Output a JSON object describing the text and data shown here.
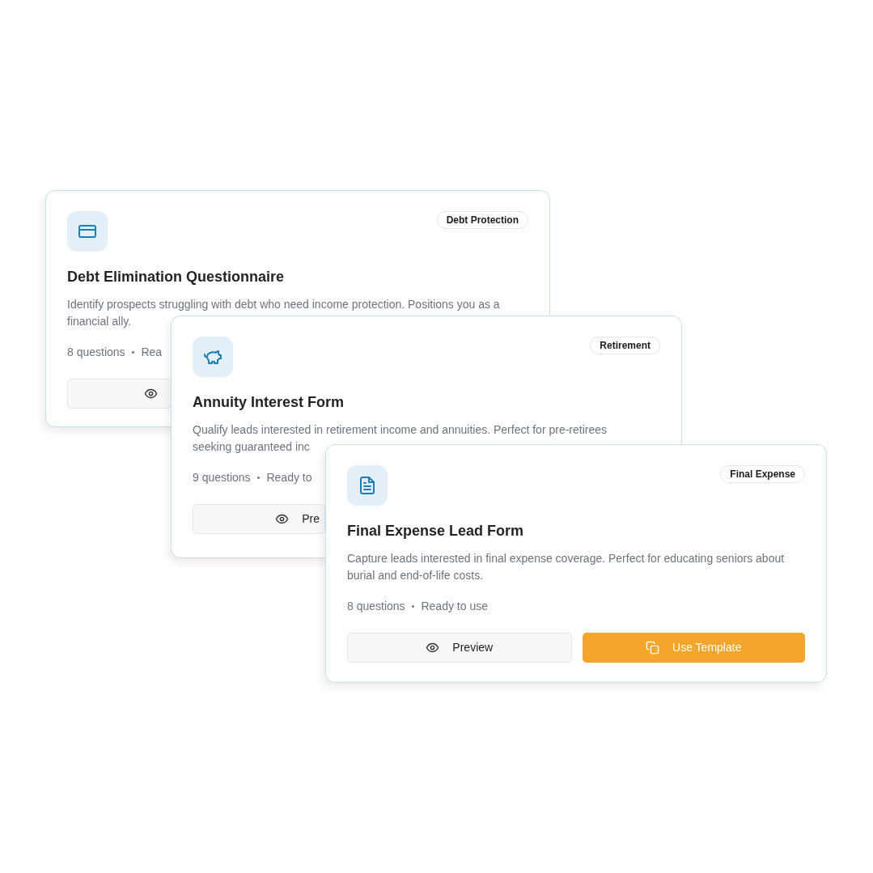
{
  "cards": [
    {
      "tag": "Debt Protection",
      "title": "Debt Elimination Questionnaire",
      "description": "Identify prospects struggling with debt who need income protection. Positions you as a financial ally.",
      "questions": "8 questions",
      "separator": "•",
      "status": "Rea",
      "buttons": [
        {
          "kind": "preview"
        }
      ]
    },
    {
      "tag": "Retirement",
      "title": "Annuity Interest Form",
      "description": "Qualify leads interested in retirement income and annuities. Perfect for pre-retirees seeking guaranteed inc",
      "questions": "9 questions",
      "separator": "•",
      "status": "Ready to",
      "buttons": [
        {
          "kind": "preview",
          "label": "Pre"
        }
      ]
    },
    {
      "tag": "Final Expense",
      "title": "Final Expense Lead Form",
      "description": "Capture leads interested in final expense coverage. Perfect for educating seniors about burial and end-of-life costs.",
      "questions": "8 questions",
      "separator": "•",
      "status": "Ready to use",
      "buttons": [
        {
          "kind": "preview",
          "label": "Preview"
        },
        {
          "kind": "use",
          "label": "Use Template"
        }
      ]
    }
  ]
}
